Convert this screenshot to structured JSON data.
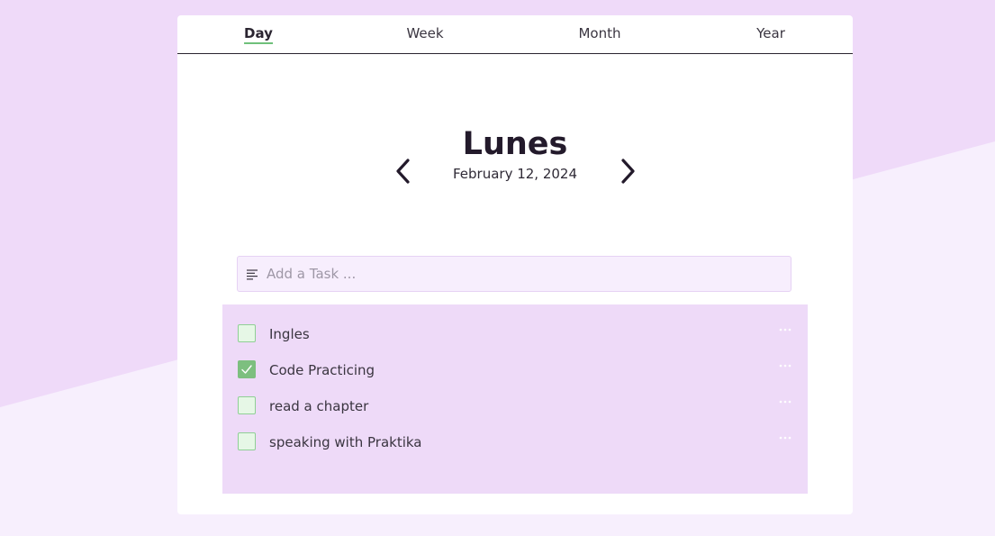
{
  "tabs": [
    {
      "label": "Day",
      "active": true
    },
    {
      "label": "Week",
      "active": false
    },
    {
      "label": "Month",
      "active": false
    },
    {
      "label": "Year",
      "active": false
    }
  ],
  "day": {
    "name": "Lunes",
    "date": "February 12, 2024",
    "prev_icon": "chevron-left-icon",
    "next_icon": "chevron-right-icon"
  },
  "add_task": {
    "placeholder": "Add a Task ...",
    "value": "",
    "icon": "text-lines-icon"
  },
  "tasks": [
    {
      "label": "Ingles",
      "done": false
    },
    {
      "label": "Code Practicing",
      "done": true
    },
    {
      "label": "read a chapter",
      "done": false
    },
    {
      "label": "speaking with Praktika",
      "done": false
    }
  ],
  "colors": {
    "background": "#f7effd",
    "background_accent": "#efdaf9",
    "card": "#ffffff",
    "task_panel": "#eedaf8",
    "active_tab_underline": "#6fc07a",
    "checkbox_checked": "#7dbf7f",
    "checkbox_unchecked": "#e6f7e6"
  }
}
